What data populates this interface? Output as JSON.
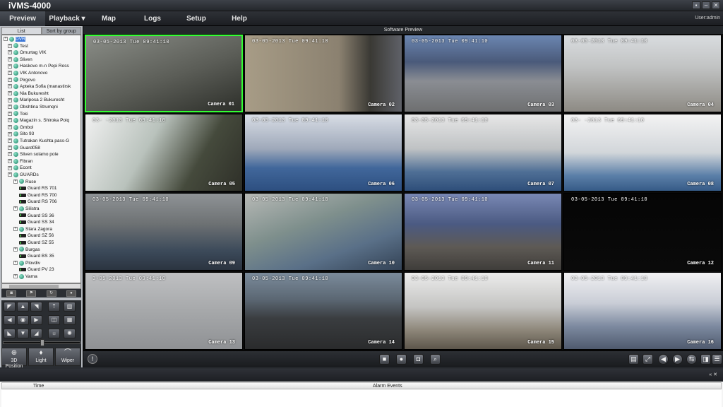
{
  "app": {
    "title": "iVMS-4000",
    "window_buttons": [
      "▪",
      "–",
      "✕"
    ]
  },
  "menu": {
    "items": [
      {
        "label": "Preview",
        "active": true
      },
      {
        "label": "Playback ▾",
        "active": false
      },
      {
        "label": "Map",
        "active": false
      },
      {
        "label": "Logs",
        "active": false
      },
      {
        "label": "Setup",
        "active": false
      },
      {
        "label": "Help",
        "active": false
      }
    ],
    "user": "User:admin"
  },
  "sidebar": {
    "tabs": [
      "List",
      "Sort by group"
    ],
    "tree": [
      {
        "label": "DVR",
        "level": 0,
        "type": "root",
        "selected": true
      },
      {
        "label": "Test",
        "level": 1,
        "type": "group"
      },
      {
        "label": "Omurtag VIK",
        "level": 1,
        "type": "group"
      },
      {
        "label": "Sliven",
        "level": 1,
        "type": "group"
      },
      {
        "label": "Haskovo m-n Pepi Ross",
        "level": 1,
        "type": "group"
      },
      {
        "label": "VIK Antonovo",
        "level": 1,
        "type": "group"
      },
      {
        "label": "Pirgovo",
        "level": 1,
        "type": "group"
      },
      {
        "label": "Apteka Sofia (manastirsk",
        "level": 1,
        "type": "group"
      },
      {
        "label": "Nia Bukuresht",
        "level": 1,
        "type": "group"
      },
      {
        "label": "Mariposa 2 Bukuresht",
        "level": 1,
        "type": "group"
      },
      {
        "label": "Obshtina Strumqni",
        "level": 1,
        "type": "group"
      },
      {
        "label": "Toki",
        "level": 1,
        "type": "group"
      },
      {
        "label": "Magazin s. Shiroka Polq",
        "level": 1,
        "type": "group"
      },
      {
        "label": "Gmbol",
        "level": 1,
        "type": "group"
      },
      {
        "label": "Sito 93",
        "level": 1,
        "type": "group"
      },
      {
        "label": "Tutrakan Kushta pass-G",
        "level": 1,
        "type": "group"
      },
      {
        "label": "Guard058",
        "level": 1,
        "type": "group"
      },
      {
        "label": "Sliven solamo pole",
        "level": 1,
        "type": "group"
      },
      {
        "label": "Fibran",
        "level": 1,
        "type": "group"
      },
      {
        "label": "Econt",
        "level": 1,
        "type": "group"
      },
      {
        "label": "GUARDs",
        "level": 1,
        "type": "group"
      },
      {
        "label": "Ruse",
        "level": 2,
        "type": "group"
      },
      {
        "label": "Guard RS 701",
        "level": 3,
        "type": "camera"
      },
      {
        "label": "Guard RS 700",
        "level": 3,
        "type": "camera"
      },
      {
        "label": "Guard RS 706",
        "level": 3,
        "type": "camera"
      },
      {
        "label": "Silistra",
        "level": 2,
        "type": "group"
      },
      {
        "label": "Guard SS 36",
        "level": 3,
        "type": "camera"
      },
      {
        "label": "Guard SS 34",
        "level": 3,
        "type": "camera"
      },
      {
        "label": "Stara Zagora",
        "level": 2,
        "type": "group"
      },
      {
        "label": "Guard SZ 56",
        "level": 3,
        "type": "camera"
      },
      {
        "label": "Guard SZ 55",
        "level": 3,
        "type": "camera"
      },
      {
        "label": "Burgas",
        "level": 2,
        "type": "group"
      },
      {
        "label": "Guard BS 35",
        "level": 3,
        "type": "camera"
      },
      {
        "label": "Plovdiv",
        "level": 2,
        "type": "group"
      },
      {
        "label": "Guard PV 23",
        "level": 3,
        "type": "camera"
      },
      {
        "label": "Varna",
        "level": 2,
        "type": "group"
      }
    ],
    "ptz_buttons": [
      "3D Position",
      "Light",
      "Wiper"
    ]
  },
  "preview": {
    "header": "Software Preview",
    "cameras": [
      {
        "name": "Camera 01",
        "timestamp": "03-05-2013 Tue 09:41:10",
        "selected": true
      },
      {
        "name": "Camera 02",
        "timestamp": "03-05-2013 Tue 09:41:10"
      },
      {
        "name": "Camera 03",
        "timestamp": "03-05-2013 Tue 09:41:10"
      },
      {
        "name": "Camera 04",
        "timestamp": "03-05-2013 Tue 09:41:10"
      },
      {
        "name": "Camera 05",
        "timestamp": "03- -2013 Tue 09:41:10"
      },
      {
        "name": "Camera 06",
        "timestamp": "03-05-2013 Tue 09:41:10"
      },
      {
        "name": "Camera 07",
        "timestamp": "03-05-2013 Tue 09:41:10"
      },
      {
        "name": "Camera 08",
        "timestamp": "03- -2013 Tue 09:41:10"
      },
      {
        "name": "Camera 09",
        "timestamp": "03-05-2013 Tue 09:41:10"
      },
      {
        "name": "Camera 10",
        "timestamp": "03-05-2013 Tue 09:41:10"
      },
      {
        "name": "Camera 11",
        "timestamp": "03-05-2013 Tue 09:41:10"
      },
      {
        "name": "Camera 12",
        "timestamp": "03-05-2013 Tue 09:41:10"
      },
      {
        "name": "Camera 13",
        "timestamp": "3-05-2013 Tue 09:41:10"
      },
      {
        "name": "Camera 14",
        "timestamp": "03-05-2013 Tue 09:41:10"
      },
      {
        "name": "Camera 15",
        "timestamp": "03-05-2013 Tue 09:41:10"
      },
      {
        "name": "Camera 16",
        "timestamp": "03-05-2013 Tue 09:41:10"
      }
    ]
  },
  "alarm": {
    "col_time": "Time",
    "col_events": "Alarm Events",
    "controls": "«  ✕"
  }
}
